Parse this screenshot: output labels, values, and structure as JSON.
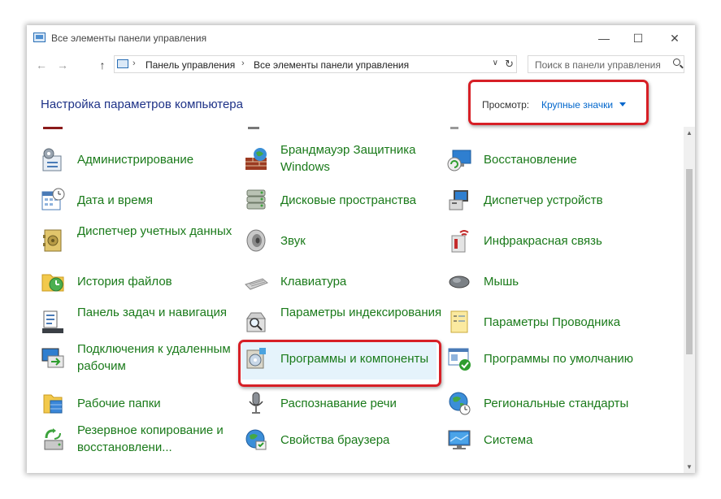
{
  "window": {
    "title": "Все элементы панели управления",
    "minimize": "—",
    "maximize": "☐",
    "close": "✕"
  },
  "nav": {
    "back": "←",
    "forward": "→",
    "up": "↑",
    "breadcrumbs": [
      "Панель управления",
      "Все элементы панели управления"
    ],
    "separator": "›",
    "dropdown": "∨",
    "refresh": "↻",
    "search_placeholder": "Поиск в панели управления"
  },
  "header": {
    "title": "Настройка параметров компьютера",
    "view_label": "Просмотр:",
    "view_value": "Крупные значки"
  },
  "items": [
    {
      "label": "Администрирование",
      "icon": "admin-tools-icon",
      "col": 0,
      "row": 0
    },
    {
      "label": "Брандмауэр Защитника Windows",
      "icon": "firewall-icon",
      "col": 1,
      "row": 0
    },
    {
      "label": "Восстановление",
      "icon": "recovery-icon",
      "col": 2,
      "row": 0
    },
    {
      "label": "Дата и время",
      "icon": "calendar-clock-icon",
      "col": 0,
      "row": 1
    },
    {
      "label": "Дисковые пространства",
      "icon": "storage-spaces-icon",
      "col": 1,
      "row": 1
    },
    {
      "label": "Диспетчер устройств",
      "icon": "device-manager-icon",
      "col": 2,
      "row": 1
    },
    {
      "label": "Диспетчер учетных данных",
      "icon": "credential-safe-icon",
      "col": 0,
      "row": 2
    },
    {
      "label": "Звук",
      "icon": "speaker-icon",
      "col": 1,
      "row": 2
    },
    {
      "label": "Инфракрасная связь",
      "icon": "infrared-icon",
      "col": 2,
      "row": 2
    },
    {
      "label": "История файлов",
      "icon": "file-history-icon",
      "col": 0,
      "row": 3
    },
    {
      "label": "Клавиатура",
      "icon": "keyboard-icon",
      "col": 1,
      "row": 3
    },
    {
      "label": "Мышь",
      "icon": "mouse-icon",
      "col": 2,
      "row": 3
    },
    {
      "label": "Панель задач и навигация",
      "icon": "taskbar-icon",
      "col": 0,
      "row": 4
    },
    {
      "label": "Параметры индексирования",
      "icon": "indexing-icon",
      "col": 1,
      "row": 4
    },
    {
      "label": "Параметры Проводника",
      "icon": "explorer-options-icon",
      "col": 2,
      "row": 4
    },
    {
      "label": "Подключения к удаленным рабочим",
      "icon": "remote-desktop-icon",
      "col": 0,
      "row": 5
    },
    {
      "label": "Программы и компоненты",
      "icon": "programs-features-icon",
      "col": 1,
      "row": 5
    },
    {
      "label": "Программы по умолчанию",
      "icon": "default-programs-icon",
      "col": 2,
      "row": 5
    },
    {
      "label": "Рабочие папки",
      "icon": "work-folders-icon",
      "col": 0,
      "row": 6
    },
    {
      "label": "Распознавание речи",
      "icon": "microphone-icon",
      "col": 1,
      "row": 6
    },
    {
      "label": "Региональные стандарты",
      "icon": "region-globe-icon",
      "col": 2,
      "row": 6
    },
    {
      "label": "Резервное копирование и восстановлени...",
      "icon": "backup-restore-icon",
      "col": 0,
      "row": 7
    },
    {
      "label": "Свойства браузера",
      "icon": "browser-properties-icon",
      "col": 1,
      "row": 7
    },
    {
      "label": "Система",
      "icon": "system-monitor-icon",
      "col": 2,
      "row": 7
    }
  ],
  "colors": {
    "link_green": "#1a7a1a",
    "heading_blue": "#1e3287",
    "view_blue": "#0066cc",
    "highlight_red": "#d71f26",
    "selected_bg": "#e5f3fb"
  }
}
